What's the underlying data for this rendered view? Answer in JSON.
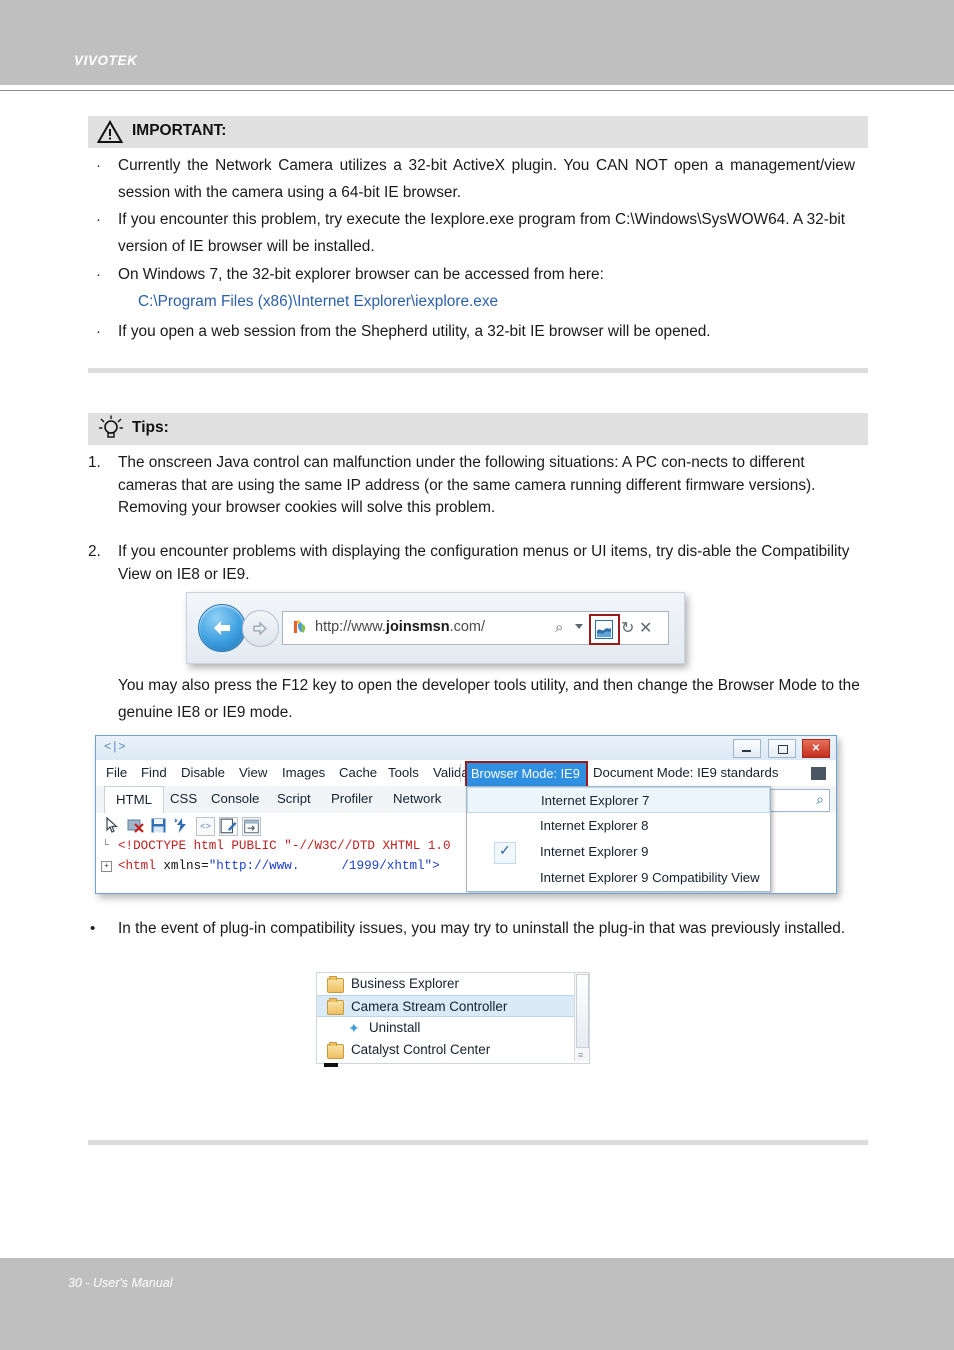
{
  "header": {
    "brand": "VIVOTEK"
  },
  "footer": {
    "text": "30 - User's Manual"
  },
  "important": {
    "title": "IMPORTANT:",
    "bullets": [
      "Currently the Network Camera utilizes a 32-bit ActiveX plugin. You CAN NOT open a management/view session with the camera using a 64-bit IE browser.",
      "If you encounter this problem, try execute the Iexplore.exe program from C:\\Windows\\SysWOW64. A 32-bit version of IE browser will be installed.",
      "On Windows 7, the 32-bit explorer browser can be accessed from here:",
      "If you open a web session from the Shepherd utility, a 32-bit IE browser will be opened."
    ],
    "link_path": "C:\\Program Files (x86)\\Internet Explorer\\iexplore.exe"
  },
  "tips": {
    "title": "Tips:",
    "items": [
      {
        "number": "1.",
        "text": "The onscreen Java control can malfunction under the following situations: A PC con-nects to different cameras that are using the same IP address (or the same camera running different firmware versions). Removing your browser cookies will solve this problem."
      },
      {
        "number": "2.",
        "text": "If you encounter problems with displaying the configuration menus or UI items, try dis-able the Compatibility View on IE8 or IE9."
      }
    ],
    "f12_paragraph": "You may also press the F12 key to open the developer tools utility, and then change the Browser Mode to the genuine IE8 or IE9 mode.",
    "plugin_bullet_marker": "•",
    "plugin_bullet": "In the event of plug-in compatibility issues, you may try to uninstall the plug-in that was previously installed."
  },
  "address_bar": {
    "url_prefix": "http://www.",
    "url_bold": "joinsmsn",
    "url_suffix": ".com/",
    "search_icon": "search-icon",
    "dropdown_caret": "caret-down-icon",
    "compat_view_icon": "compatibility-view-icon",
    "refresh_icon": "↻",
    "stop_icon": "✕"
  },
  "dev_tools": {
    "window_glyph": "<|>",
    "menu": [
      "File",
      "Find",
      "Disable",
      "View",
      "Images",
      "Cache",
      "Tools",
      "Validate"
    ],
    "browser_mode": "Browser Mode:  IE9",
    "document_mode": "Document Mode:  IE9 standards",
    "tabs": [
      "HTML",
      "CSS",
      "Console",
      "Script",
      "Profiler",
      "Network"
    ],
    "active_tab": "HTML",
    "dropdown_items": [
      {
        "label": "Internet Explorer 7",
        "checked": false,
        "hover": true
      },
      {
        "label": "Internet Explorer 8",
        "checked": false,
        "hover": false
      },
      {
        "label": "Internet Explorer 9",
        "checked": true,
        "hover": false
      },
      {
        "label": "Internet Explorer 9 Compatibility View",
        "checked": false,
        "hover": false
      }
    ],
    "check_glyph": "✓",
    "code": {
      "line1_red": "<!DOCTYPE html PUBLIC \"-//W3C//DTD XHTML 1.0 ",
      "line2_red_a": "<html ",
      "line2_black": "xmlns=",
      "line2_blue_a": "\"http://www.",
      "line2_blue_b": "/1999/xhtml\">",
      "line2_red_b": ">"
    },
    "toolbar_icons": [
      "pointer-icon",
      "clear-browser-cache-icon",
      "save-icon",
      "refresh-styles-icon",
      "view-source-icon",
      "edit-icon",
      "outline-icon"
    ]
  },
  "programs_list": {
    "rows": [
      {
        "label": "Business Explorer",
        "icon": "folder-icon",
        "selected": false,
        "indent": 0
      },
      {
        "label": "Camera Stream Controller",
        "icon": "folder-icon",
        "selected": true,
        "indent": 0
      },
      {
        "label": "Uninstall",
        "icon": "puzzle-icon",
        "selected": false,
        "indent": 1
      },
      {
        "label": "Catalyst Control Center",
        "icon": "folder-icon",
        "selected": false,
        "indent": 0
      }
    ]
  },
  "colors": {
    "page_bar": "#bfbfbf",
    "callout_header_bg": "#e0e0e0",
    "separator": "#dcdcdc",
    "link_blue": "#2b5faa",
    "highlight_red": "#9b1b1b",
    "highlight_blue": "#2f8fe0"
  }
}
